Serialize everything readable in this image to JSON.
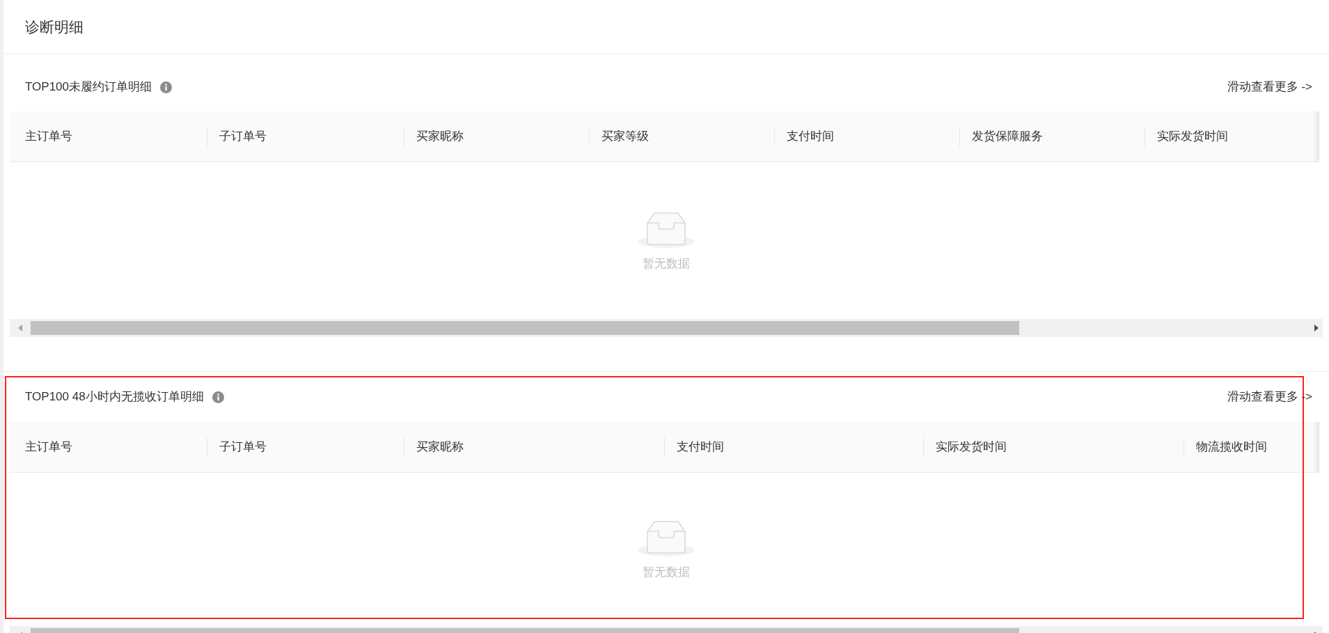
{
  "title": "诊断明细",
  "sections": [
    {
      "title": "TOP100未履约订单明细",
      "more_link": "滑动查看更多 ->",
      "columns": [
        "主订单号",
        "子订单号",
        "买家昵称",
        "买家等级",
        "支付时间",
        "发货保障服务",
        "实际发货时间"
      ],
      "empty_text": "暂无数据",
      "highlighted": false
    },
    {
      "title": "TOP100 48小时内无揽收订单明细",
      "more_link": "滑动查看更多 ->",
      "columns": [
        "主订单号",
        "子订单号",
        "买家昵称",
        "支付时间",
        "实际发货时间",
        "物流揽收时间"
      ],
      "empty_text": "暂无数据",
      "highlighted": true
    }
  ]
}
